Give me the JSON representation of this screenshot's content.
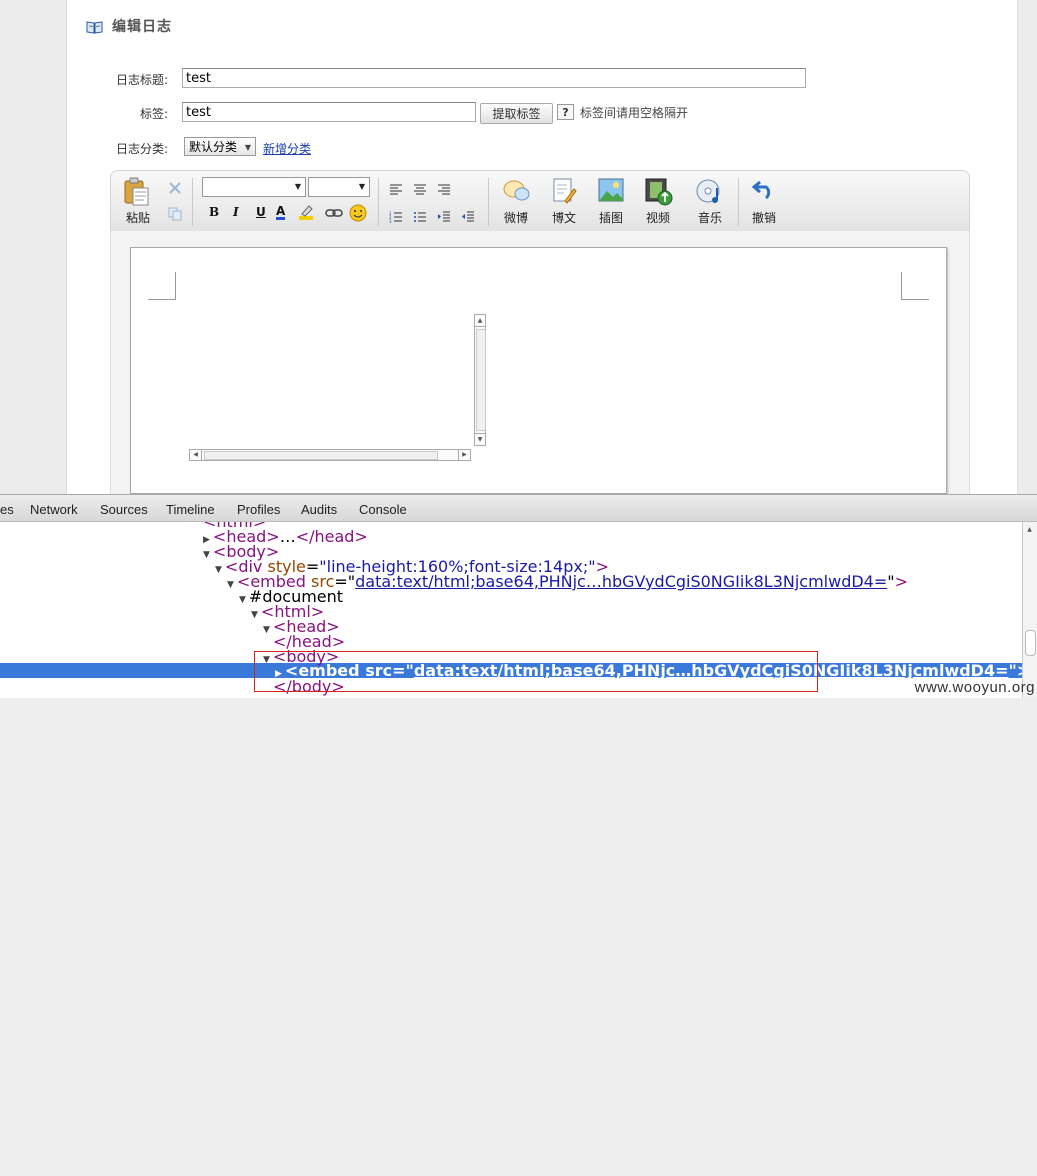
{
  "header": {
    "title": "编辑日志"
  },
  "form": {
    "title_label": "日志标题:",
    "title_value": "test",
    "tags_label": "标签:",
    "tags_value": "test",
    "fetch_tags_button": "提取标签",
    "help_icon": "?",
    "tags_hint": "标签间请用空格隔开",
    "category_label": "日志分类:",
    "category_selected": "默认分类",
    "add_category_link": "新增分类"
  },
  "toolbar": {
    "paste": "粘贴",
    "weibo": "微博",
    "blog": "博文",
    "image": "插图",
    "video": "视频",
    "music": "音乐",
    "undo": "撤销",
    "bold": "B",
    "italic": "I",
    "underline": "U",
    "font_color": "A"
  },
  "devtools": {
    "tabs": [
      "es",
      "Network",
      "Sources",
      "Timeline",
      "Profiles",
      "Audits",
      "Console"
    ],
    "dom": {
      "l0": "<html>",
      "head_open": "<head>",
      "head_ellipsis": "…",
      "head_close": "</head>",
      "body": "<body>",
      "div_open": "<div",
      "div_attr": "style",
      "div_val": "\"line-height:160%;font-size:14px;\"",
      "div_close": ">",
      "embed_open": "<embed",
      "embed_attr": "src",
      "embed_url": "data:text/html;base64,PHNjc…hbGVydCgiS0NGIik8L3NjcmlwdD4=",
      "embed_close": ">",
      "document": "#document",
      "html_inner": "<html>",
      "head_inner": "<head>",
      "head_inner_close": "</head>",
      "body_inner": "<body>",
      "embed2_url": "data:text/html;base64,PHNjc…hbGVydCgiS0NGIik8L3NjcmlwdD4=",
      "body_inner_close": "</body>"
    }
  },
  "watermark": "www.wooyun.org"
}
